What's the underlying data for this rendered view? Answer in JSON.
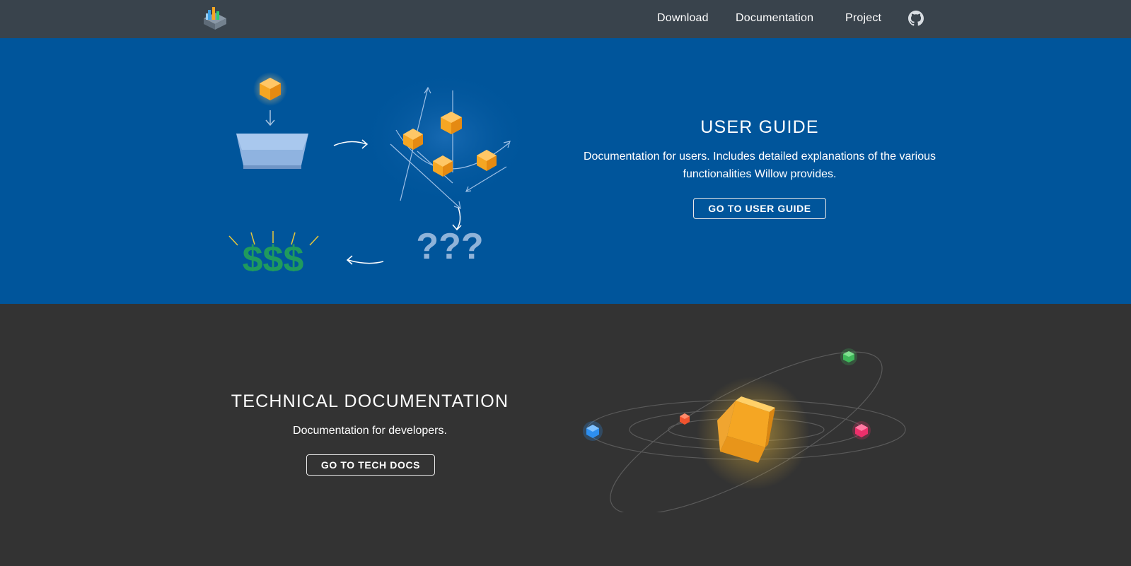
{
  "navbar": {
    "logo_icon": "willow-logo-icon",
    "links": [
      "Download",
      "Documentation",
      "Project"
    ],
    "github_icon": "github-icon",
    "bg_color": "#39434c"
  },
  "user_guide": {
    "title": "USER GUIDE",
    "description": "Documentation for users. Includes detailed explanations of the various functionalities Willow provides.",
    "button_label": "GO TO USER GUIDE",
    "illustration": {
      "dollar_text": "$$$",
      "question_text": "???"
    },
    "bg_color": "#00559b"
  },
  "tech_docs": {
    "title": "TECHNICAL DOCUMENTATION",
    "description": "Documentation for developers.",
    "button_label": "GO TO TECH DOCS",
    "bg_color": "#333333"
  },
  "colors": {
    "accent_orange": "#f5a623",
    "dollar_green": "#1f9a5e",
    "question_blue": "#8fb3d9",
    "planet_green": "#3fb85a",
    "planet_red": "#f0532e",
    "planet_blue": "#2d8ff0",
    "planet_pink": "#ee2f6b"
  }
}
